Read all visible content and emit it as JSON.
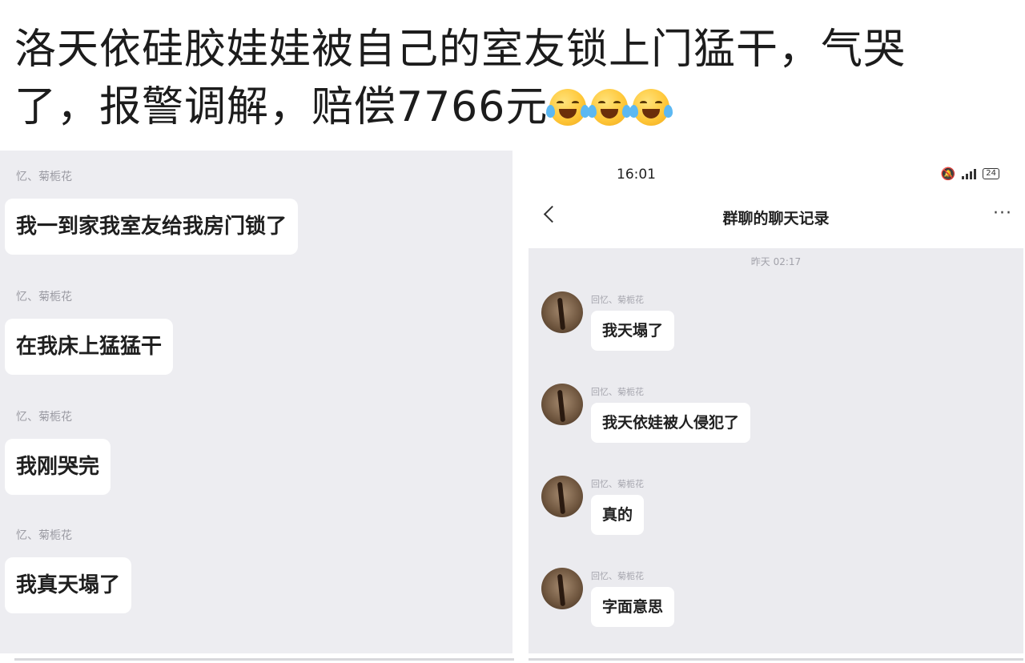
{
  "headline": {
    "line1": "洛天依硅胶娃娃被自己的室友锁上门猛干，气哭",
    "line2": "了，报警调解，赔偿7766元",
    "emoji_icon": "tears-of-joy-emoji",
    "emoji_count": 3
  },
  "left_chat": {
    "messages": [
      {
        "sender": "忆、菊栀花",
        "text": "我一到家我室友给我房门锁了"
      },
      {
        "sender": "忆、菊栀花",
        "text": "在我床上猛猛干"
      },
      {
        "sender": "忆、菊栀花",
        "text": "我刚哭完"
      },
      {
        "sender": "忆、菊栀花",
        "text": "我真天塌了"
      }
    ]
  },
  "right_chat": {
    "status_time": "16:01",
    "battery": "24",
    "title": "群聊的聊天记录",
    "more": "···",
    "timestamp": "昨天 02:17",
    "messages": [
      {
        "sender": "回忆、菊栀花",
        "text": "我天塌了"
      },
      {
        "sender": "回忆、菊栀花",
        "text": "我天依娃被人侵犯了"
      },
      {
        "sender": "回忆、菊栀花",
        "text": "真的"
      },
      {
        "sender": "回忆、菊栀花",
        "text": "字面意思"
      }
    ]
  }
}
